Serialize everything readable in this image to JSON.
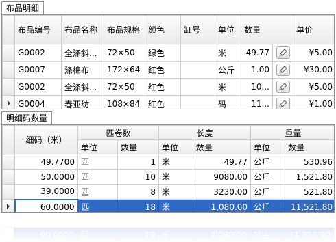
{
  "top_tab": {
    "label": "布品明细"
  },
  "top_table": {
    "headers": [
      "布品编号",
      "布品名称",
      "布品规格",
      "颜色",
      "缸号",
      "单位",
      "数量",
      "",
      "单价"
    ],
    "rows": [
      {
        "code": "G0002",
        "name": "全涤斜...",
        "spec": "72×50",
        "color": "绿色",
        "vat": "",
        "unit": "米",
        "qty": "49.77",
        "price": "¥5.00",
        "current": false
      },
      {
        "code": "G0007",
        "name": "涤棉布",
        "spec": "172×64",
        "color": "红色",
        "vat": "",
        "unit": "公斤",
        "qty": "1.00",
        "price": "¥30.00",
        "current": false
      },
      {
        "code": "G0002",
        "name": "全涤斜...",
        "spec": "72×50",
        "color": "红色",
        "vat": "",
        "unit": "米",
        "qty": "10...",
        "price": "¥5.00",
        "current": false
      },
      {
        "code": "G0004",
        "name": "春亚纺",
        "spec": "108×84",
        "color": "红色",
        "vat": "",
        "unit": "码",
        "qty": "11...",
        "price": "¥1.00",
        "current": true
      }
    ]
  },
  "bottom_tab": {
    "label": "明细码数量"
  },
  "bottom_table": {
    "band_headers": {
      "code": "细码（米）",
      "rolls": "匹卷数",
      "length": "长度",
      "weight": "重量"
    },
    "sub_headers": {
      "unit": "单位",
      "qty": "数量"
    },
    "rows": [
      {
        "code": "49.7700",
        "roll_unit": "匹",
        "roll_qty": "1",
        "len_unit": "米",
        "len_qty": "49.77",
        "wt_unit": "公斤",
        "wt_qty": "530.96",
        "selected": false
      },
      {
        "code": "50.0000",
        "roll_unit": "匹",
        "roll_qty": "10",
        "len_unit": "米",
        "len_qty": "9080.00",
        "wt_unit": "公斤",
        "wt_qty": "1,521.80",
        "selected": false
      },
      {
        "code": "39.0000",
        "roll_unit": "匹",
        "roll_qty": "8",
        "len_unit": "米",
        "len_qty": "3230.00",
        "wt_unit": "公斤",
        "wt_qty": "521.80",
        "selected": false
      },
      {
        "code": "60.0000",
        "roll_unit": "匹",
        "roll_qty": "18",
        "len_unit": "米",
        "len_qty": "1,080.00",
        "wt_unit": "公斤",
        "wt_qty": "11,521.80",
        "selected": true
      }
    ]
  },
  "icons": {
    "row_indicator": "triangle-right-icon",
    "edit": "pencil-icon"
  },
  "colors": {
    "selection": "#316ac5",
    "grid_line": "#cfcfcf",
    "header_bg": "#ebebeb"
  }
}
